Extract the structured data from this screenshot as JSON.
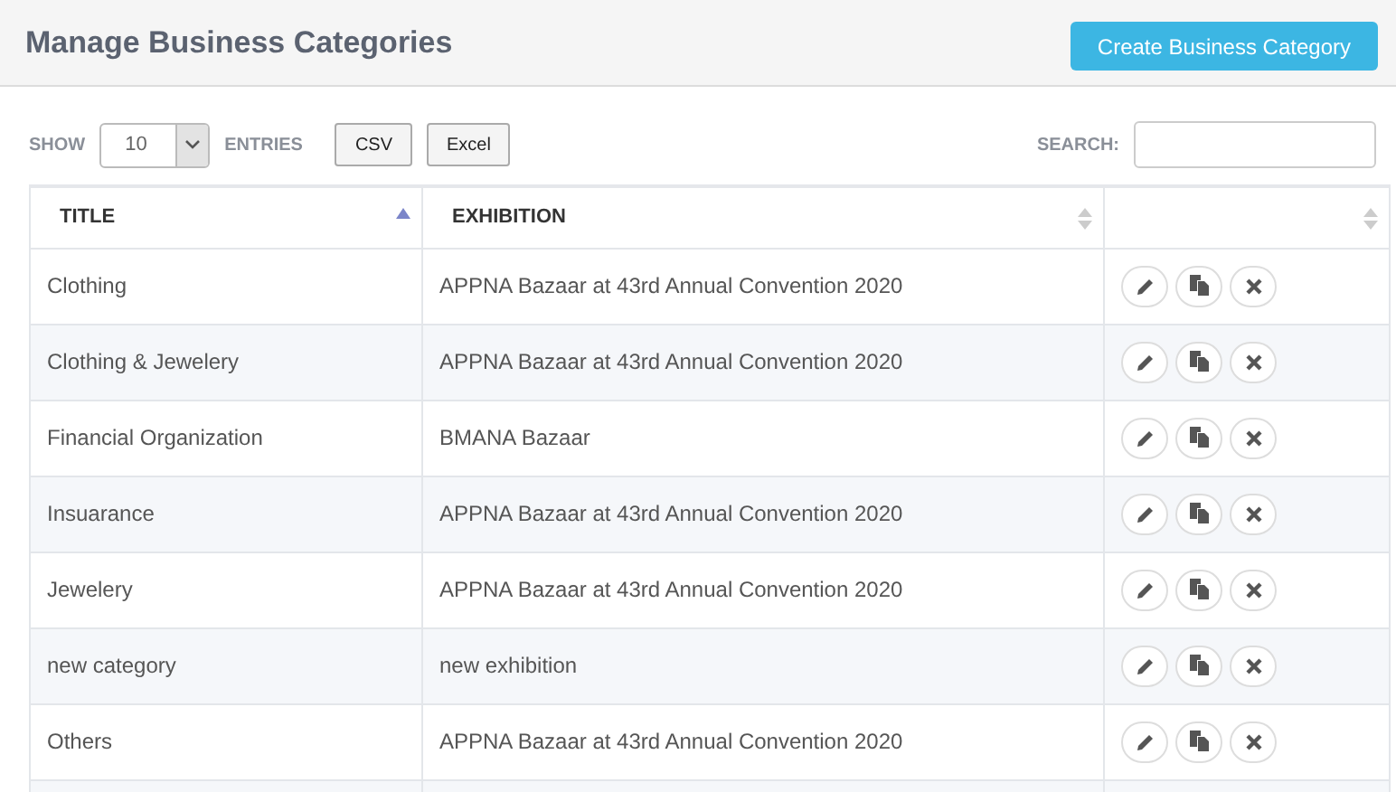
{
  "header": {
    "title": "Manage Business Categories",
    "create_button": "Create Business Category"
  },
  "toolbar": {
    "show_label": "SHOW",
    "entries_value": "10",
    "entries_label": "ENTRIES",
    "export_buttons": [
      "CSV",
      "Excel"
    ],
    "search_label": "SEARCH:"
  },
  "table": {
    "columns": [
      {
        "label": "TITLE",
        "sorted": true
      },
      {
        "label": "EXHIBITION",
        "sorted": false
      },
      {
        "sorted": false
      }
    ],
    "rows": [
      {
        "title": "Clothing",
        "exhibition": "APPNA Bazaar at 43rd Annual Convention 2020"
      },
      {
        "title": "Clothing & Jewelery",
        "exhibition": "APPNA Bazaar at 43rd Annual Convention 2020"
      },
      {
        "title": "Financial Organization",
        "exhibition": "BMANA Bazaar"
      },
      {
        "title": "Insuarance",
        "exhibition": "APPNA Bazaar at 43rd Annual Convention 2020"
      },
      {
        "title": "Jewelery",
        "exhibition": "APPNA Bazaar at 43rd Annual Convention 2020"
      },
      {
        "title": "new category",
        "exhibition": "new exhibition"
      },
      {
        "title": "Others",
        "exhibition": "APPNA Bazaar at 43rd Annual Convention 2020"
      }
    ]
  }
}
